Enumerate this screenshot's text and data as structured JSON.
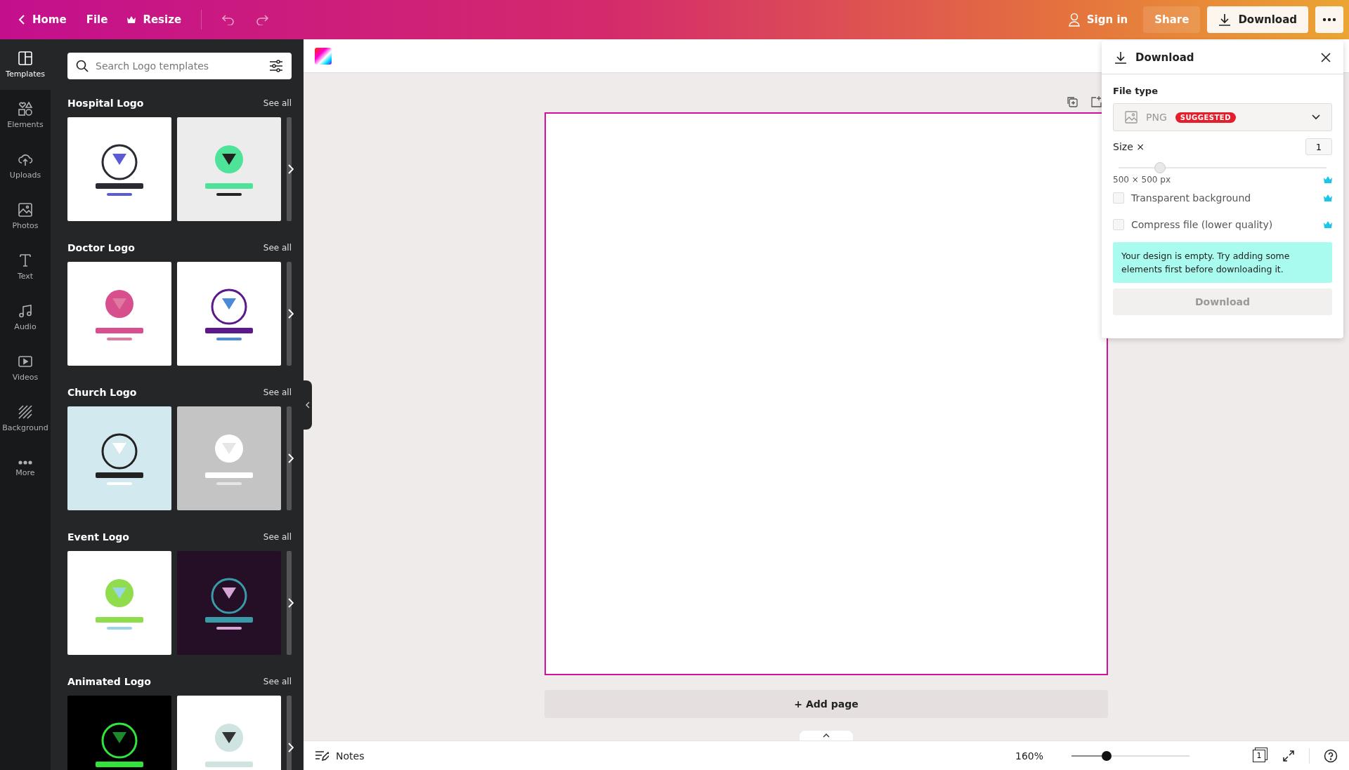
{
  "top_bar": {
    "home": "Home",
    "file": "File",
    "resize": "Resize",
    "sign_in": "Sign in",
    "share": "Share",
    "download": "Download"
  },
  "rail": [
    {
      "label": "Templates",
      "selected": true
    },
    {
      "label": "Elements",
      "selected": false
    },
    {
      "label": "Uploads",
      "selected": false
    },
    {
      "label": "Photos",
      "selected": false
    },
    {
      "label": "Text",
      "selected": false
    },
    {
      "label": "Audio",
      "selected": false
    },
    {
      "label": "Videos",
      "selected": false
    },
    {
      "label": "Background",
      "selected": false
    },
    {
      "label": "More",
      "selected": false
    }
  ],
  "panel": {
    "search": {
      "placeholder": "Search Logo templates"
    },
    "sections": [
      {
        "title": "Hospital Logo",
        "see_all": "See all"
      },
      {
        "title": "Doctor Logo",
        "see_all": "See all"
      },
      {
        "title": "Church Logo",
        "see_all": "See all"
      },
      {
        "title": "Event Logo",
        "see_all": "See all"
      },
      {
        "title": "Animated Logo",
        "see_all": "See all"
      }
    ]
  },
  "canvas": {
    "add_page": "+ Add page"
  },
  "download_panel": {
    "title": "Download",
    "file_type_label": "File type",
    "file_type": "PNG",
    "badge": "SUGGESTED",
    "size_label": "Size ×",
    "size_value": "1",
    "size_slider": {
      "level": 0.2
    },
    "dimensions": "500 × 500 px",
    "options": [
      {
        "label": "Transparent background",
        "checked": false
      },
      {
        "label": "Compress file (lower quality)",
        "checked": false
      }
    ],
    "notice": "Your design is empty. Try adding some elements first before downloading it.",
    "button": {
      "label": "Download",
      "disabled": true
    }
  },
  "bottom_bar": {
    "notes": "Notes",
    "zoom": "160%",
    "zoom_slider": {
      "level": 0.3
    },
    "page_count": "1"
  }
}
